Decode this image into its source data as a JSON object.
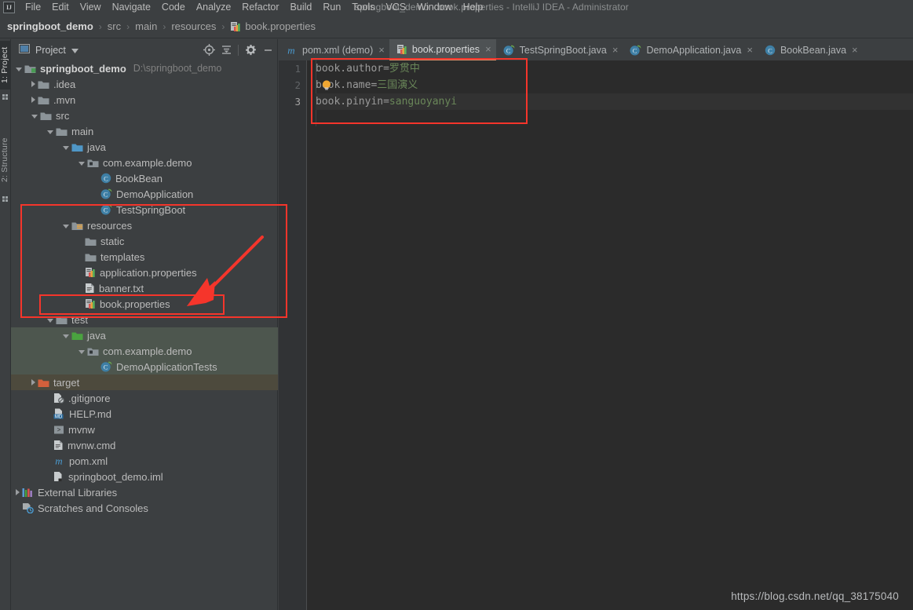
{
  "window": {
    "title": "springboot_demo - book.properties - IntelliJ IDEA - Administrator",
    "logo": "IJ"
  },
  "menubar": {
    "items": [
      {
        "label": "File",
        "mnemonic": "F"
      },
      {
        "label": "Edit",
        "mnemonic": "E"
      },
      {
        "label": "View",
        "mnemonic": "V"
      },
      {
        "label": "Navigate",
        "mnemonic": "N"
      },
      {
        "label": "Code",
        "mnemonic": "C"
      },
      {
        "label": "Analyze",
        "mnemonic": "z"
      },
      {
        "label": "Refactor",
        "mnemonic": "R"
      },
      {
        "label": "Build",
        "mnemonic": "B"
      },
      {
        "label": "Run",
        "mnemonic": "u"
      },
      {
        "label": "Tools",
        "mnemonic": "T"
      },
      {
        "label": "VCS",
        "mnemonic": "V"
      },
      {
        "label": "Window",
        "mnemonic": "W"
      },
      {
        "label": "Help",
        "mnemonic": "H"
      }
    ]
  },
  "breadcrumb": {
    "items": [
      {
        "label": "springboot_demo",
        "bold": true,
        "icon": null
      },
      {
        "label": "src",
        "bold": false,
        "icon": null
      },
      {
        "label": "main",
        "bold": false,
        "icon": null
      },
      {
        "label": "resources",
        "bold": false,
        "icon": null
      },
      {
        "label": "book.properties",
        "bold": false,
        "icon": "properties-file-icon"
      }
    ],
    "separator": "›"
  },
  "toolstrip": {
    "tabs": [
      {
        "label": "1: Project",
        "active": true
      },
      {
        "label": "2: Structure",
        "active": false
      }
    ]
  },
  "project_panel": {
    "title": "Project",
    "dropdown_icon": "chevron-down-icon",
    "tools": [
      {
        "name": "locate-icon",
        "title": "Select Opened File"
      },
      {
        "name": "collapse-all-icon",
        "title": "Collapse All"
      },
      {
        "name": "gear-icon",
        "title": "Settings"
      },
      {
        "name": "minimize-icon",
        "title": "Hide"
      }
    ],
    "tree": [
      {
        "label": "springboot_demo",
        "path": "D:\\springboot_demo",
        "indent": 0,
        "arrow": "open",
        "icon": "module-folder-icon",
        "bold": true,
        "highlight": "none"
      },
      {
        "label": ".idea",
        "indent": 1,
        "arrow": "closed",
        "icon": "folder-icon",
        "bold": false,
        "highlight": "none"
      },
      {
        "label": ".mvn",
        "indent": 1,
        "arrow": "closed",
        "icon": "folder-icon",
        "bold": false,
        "highlight": "none"
      },
      {
        "label": "src",
        "indent": 1,
        "arrow": "open",
        "icon": "folder-icon",
        "bold": false,
        "highlight": "none"
      },
      {
        "label": "main",
        "indent": 2,
        "arrow": "open",
        "icon": "folder-icon",
        "bold": false,
        "highlight": "none"
      },
      {
        "label": "java",
        "indent": 3,
        "arrow": "open",
        "icon": "source-root-icon",
        "bold": false,
        "highlight": "none"
      },
      {
        "label": "com.example.demo",
        "indent": 4,
        "arrow": "open",
        "icon": "package-icon",
        "bold": false,
        "highlight": "none"
      },
      {
        "label": "BookBean",
        "indent": 5,
        "arrow": "none",
        "icon": "class-icon",
        "bold": false,
        "highlight": "none"
      },
      {
        "label": "DemoApplication",
        "indent": 5,
        "arrow": "none",
        "icon": "spring-class-icon",
        "bold": false,
        "highlight": "none"
      },
      {
        "label": "TestSpringBoot",
        "indent": 5,
        "arrow": "none",
        "icon": "spring-class-icon",
        "bold": false,
        "highlight": "none"
      },
      {
        "label": "resources",
        "indent": 3,
        "arrow": "open",
        "icon": "resource-root-icon",
        "bold": false,
        "highlight": "none"
      },
      {
        "label": "static",
        "indent": 4,
        "arrow": "none",
        "icon": "folder-icon",
        "bold": false,
        "highlight": "none"
      },
      {
        "label": "templates",
        "indent": 4,
        "arrow": "none",
        "icon": "folder-icon",
        "bold": false,
        "highlight": "none"
      },
      {
        "label": "application.properties",
        "indent": 4,
        "arrow": "none",
        "icon": "properties-file-icon",
        "bold": false,
        "highlight": "none"
      },
      {
        "label": "banner.txt",
        "indent": 4,
        "arrow": "none",
        "icon": "text-file-icon",
        "bold": false,
        "highlight": "none"
      },
      {
        "label": "book.properties",
        "indent": 4,
        "arrow": "none",
        "icon": "properties-file-icon",
        "bold": false,
        "highlight": "none"
      },
      {
        "label": "test",
        "indent": 2,
        "arrow": "open",
        "icon": "folder-icon",
        "bold": false,
        "highlight": "none"
      },
      {
        "label": "java",
        "indent": 3,
        "arrow": "open",
        "icon": "test-source-root-icon",
        "bold": false,
        "highlight": "testsrc"
      },
      {
        "label": "com.example.demo",
        "indent": 4,
        "arrow": "open",
        "icon": "package-icon",
        "bold": false,
        "highlight": "testsrc"
      },
      {
        "label": "DemoApplicationTests",
        "indent": 5,
        "arrow": "none",
        "icon": "spring-class-icon",
        "bold": false,
        "highlight": "testsrc"
      },
      {
        "label": "target",
        "indent": 1,
        "arrow": "closed",
        "icon": "excluded-folder-icon",
        "bold": false,
        "highlight": "target"
      },
      {
        "label": ".gitignore",
        "indent": 2,
        "arrow": "none",
        "icon": "gitignore-file-icon",
        "bold": false,
        "highlight": "none"
      },
      {
        "label": "HELP.md",
        "indent": 2,
        "arrow": "none",
        "icon": "markdown-file-icon",
        "bold": false,
        "highlight": "none"
      },
      {
        "label": "mvnw",
        "indent": 2,
        "arrow": "none",
        "icon": "shell-script-icon",
        "bold": false,
        "highlight": "none"
      },
      {
        "label": "mvnw.cmd",
        "indent": 2,
        "arrow": "none",
        "icon": "text-file-icon",
        "bold": false,
        "highlight": "none"
      },
      {
        "label": "pom.xml",
        "indent": 2,
        "arrow": "none",
        "icon": "maven-file-icon",
        "bold": false,
        "highlight": "none"
      },
      {
        "label": "springboot_demo.iml",
        "indent": 2,
        "arrow": "none",
        "icon": "iml-file-icon",
        "bold": false,
        "highlight": "none"
      },
      {
        "label": "External Libraries",
        "indent": 0,
        "arrow": "closed",
        "icon": "libraries-icon",
        "bold": false,
        "highlight": "none"
      },
      {
        "label": "Scratches and Consoles",
        "indent": 0,
        "arrow": "none",
        "icon": "scratches-icon",
        "bold": false,
        "highlight": "none"
      }
    ]
  },
  "editor": {
    "tabs": [
      {
        "label": "pom.xml (demo)",
        "icon": "maven-file-icon",
        "active": false,
        "close": "×"
      },
      {
        "label": "book.properties",
        "icon": "properties-file-icon",
        "active": true,
        "close": "×"
      },
      {
        "label": "TestSpringBoot.java",
        "icon": "spring-class-icon",
        "active": false,
        "close": "×"
      },
      {
        "label": "DemoApplication.java",
        "icon": "spring-class-icon",
        "active": false,
        "close": "×"
      },
      {
        "label": "BookBean.java",
        "icon": "class-icon",
        "active": false,
        "close": "×"
      }
    ],
    "lines": [
      {
        "number": "1",
        "key": "book.author",
        "eq": "=",
        "value": "罗贯中",
        "typo": false,
        "current": false,
        "bulb": false
      },
      {
        "number": "2",
        "key": "book.name",
        "eq": "=",
        "value": "三国演义",
        "typo": false,
        "current": false,
        "bulb": true
      },
      {
        "number": "3",
        "key": "book.pinyin",
        "eq": "=",
        "value": "sanguoyanyi",
        "typo": true,
        "current": true,
        "bulb": false
      }
    ]
  },
  "annotations": {
    "code_box": "highlight-code-box",
    "resources_box": "highlight-resources-box",
    "book_properties_box": "highlight-book-properties-box",
    "arrow": "red-arrow-pointing-to-book-properties",
    "color": "#f5352b"
  },
  "watermark": {
    "text": "https://blog.csdn.net/qq_38175040"
  }
}
